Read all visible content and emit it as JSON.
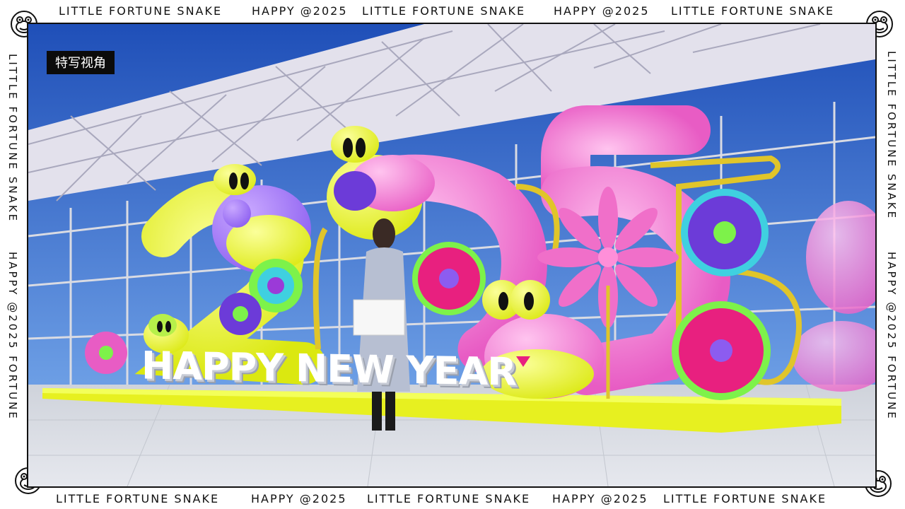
{
  "frame": {
    "top_texts": [
      "LITTLE FORTUNE SNAKE",
      "HAPPY @2025",
      "LITTLE FORTUNE SNAKE",
      "HAPPY @2025",
      "LITTLE FORTUNE SNAKE"
    ],
    "bottom_texts": [
      "LITTLE FORTUNE SNAKE",
      "HAPPY @2025",
      "LITTLE FORTUNE SNAKE",
      "HAPPY @2025",
      "LITTLE FORTUNE SNAKE"
    ],
    "left_texts": [
      "LITTLE FORTUNE SNAKE",
      "HAPPY @2025 FORTUNE"
    ],
    "right_texts": [
      "LITTLE FORTUNE SNAKE",
      "HAPPY @2025 FORTUNE"
    ]
  },
  "badge": {
    "label": "特写视角"
  },
  "scene": {
    "sign_text": "HAPPY NEW YEAR",
    "sky_color": "#2d63c9",
    "sculpture_pink": "#f06fc9",
    "sculpture_yellow": "#e9f52a",
    "accent_purple": "#7c4df0",
    "accent_green": "#7df24a"
  }
}
